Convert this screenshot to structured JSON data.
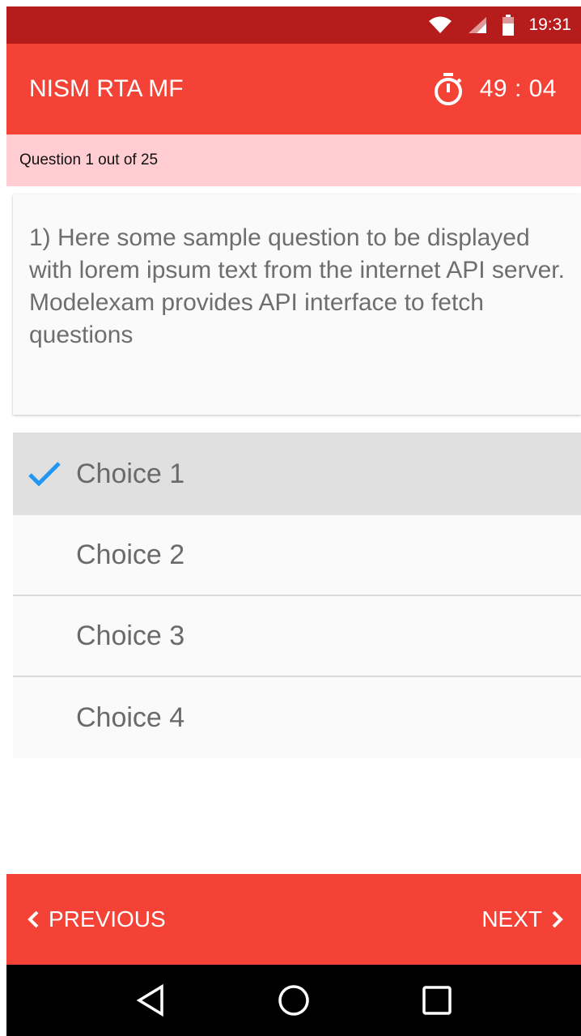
{
  "status_bar": {
    "time": "19:31",
    "icons": [
      "wifi-icon",
      "signal-icon",
      "battery-icon"
    ]
  },
  "app_bar": {
    "title": "NISM RTA MF",
    "timer_icon": "stopwatch-icon",
    "timer_value": "49 : 04"
  },
  "progress": {
    "text": "Question 1 out of 25"
  },
  "question": {
    "text": "1)  Here some sample question to be displayed with lorem ipsum text from the internet API server. Modelexam provides API interface to fetch questions"
  },
  "choices": [
    {
      "label": "Choice 1",
      "selected": true
    },
    {
      "label": "Choice 2",
      "selected": false
    },
    {
      "label": "Choice 3",
      "selected": false
    },
    {
      "label": "Choice 4",
      "selected": false
    }
  ],
  "navigation": {
    "previous_label": "PREVIOUS",
    "next_label": "NEXT"
  },
  "system_nav": {
    "icons": [
      "back-icon",
      "home-icon",
      "recents-icon"
    ]
  },
  "colors": {
    "status_bar": "#b71c1c",
    "primary": "#f44336",
    "progress_strip": "#ffcdd2",
    "check": "#2196f3",
    "selected_choice": "#e0e0e0"
  }
}
